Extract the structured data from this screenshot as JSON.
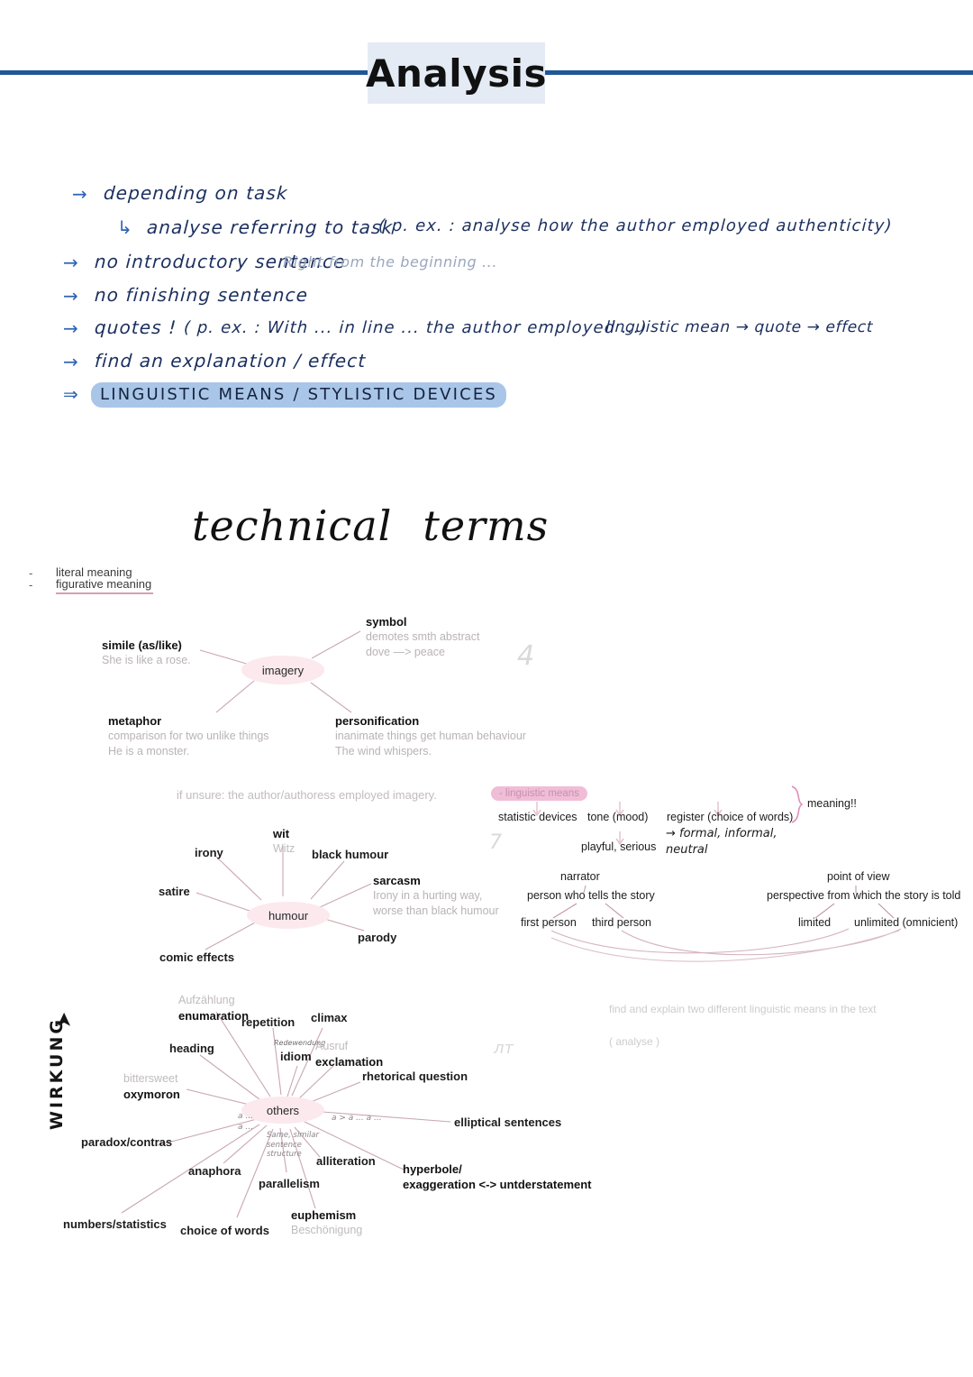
{
  "header": {
    "title": "Analysis",
    "rule_color": "#1f5797",
    "title_box_color": "#e4ebf4"
  },
  "notes": {
    "arrow_glyph": "→",
    "sub_arrow_glyph": "↳",
    "double_arrow_glyph": "⇒",
    "lines": [
      {
        "arrow": "→",
        "text": "depending  on  task"
      },
      {
        "arrow": "↳",
        "text": "analyse  referring  to  task",
        "extra": "( p. ex. :  analyse  how  the  author  employed  authenticity)"
      },
      {
        "arrow": "→",
        "text": "no  introductory  sentence",
        "faint": "Right  from  the  beginning ..."
      },
      {
        "arrow": "→",
        "text": "no  finishing  sentence"
      },
      {
        "arrow": "→",
        "text": "quotes !",
        "extra": "( p. ex. :  With  ...  in line ...  the author  employed ...)"
      },
      {
        "arrow": "→",
        "text": "find  an  explanation / effect"
      }
    ],
    "side_note": "linguistic mean → quote → effect",
    "highlight_line": {
      "arrow": "⇒",
      "text": "LINGUISTIC  MEANS  /  STYLISTIC  DEVICES",
      "highlight_color": "#a9c6e8"
    }
  },
  "technical_terms": {
    "word1": "technical",
    "word2": "terms"
  },
  "meanings": {
    "dash": "-",
    "items": [
      "literal meaning",
      "figurative meaning"
    ],
    "underline_color": "#cf8fa2"
  },
  "imagery_map": {
    "center": "imagery",
    "page_number": "4",
    "nodes": [
      {
        "title": "symbol",
        "desc1": "demotes smth abstract",
        "desc2": "dove —> peace"
      },
      {
        "title": "simile (as/like)",
        "desc1": "She is like a rose."
      },
      {
        "title": "metaphor",
        "desc1": "comparison for two unlike things",
        "desc2": "He is a monster."
      },
      {
        "title": "personification",
        "desc1": "inanimate things get human behaviour",
        "desc2": "The wind whispers."
      }
    ],
    "hint": "if unsure: the author/authoress employed imagery."
  },
  "humour_map": {
    "center": "humour",
    "pencil_mark": "7",
    "nodes": [
      {
        "title": "wit",
        "german": "Witz"
      },
      {
        "title": "irony"
      },
      {
        "title": "black humour"
      },
      {
        "title": "satire"
      },
      {
        "title": "sarcasm",
        "desc1": "Irony in a hurting way,",
        "desc2": "worse than black humour"
      },
      {
        "title": "parody"
      },
      {
        "title": "comic effects"
      }
    ]
  },
  "linguistic_means_tree": {
    "root_label": "- linguistic means",
    "root_highlight": "#f0bdd6",
    "arrow_glyph": "↓",
    "children": [
      "statistic devices",
      "tone (mood)",
      "register (choice of words)"
    ],
    "tone_child": "playful, serious",
    "register_handwritten": "→ formal, informal,\n      neutral",
    "brace_label": "meaning!!"
  },
  "narrator_tree": {
    "root": "narrator",
    "definition": "person who tells the story",
    "children": [
      "first person",
      "third person"
    ]
  },
  "pov_tree": {
    "root": "point of view",
    "definition": "perspective from which the story is told",
    "children": [
      "limited",
      "unlimited (omnicient)"
    ]
  },
  "others_map": {
    "center": "others",
    "pencil_mark": "лт",
    "nodes": [
      {
        "title": "enumaration",
        "german": "Aufzählung"
      },
      {
        "title": "repetition"
      },
      {
        "title": "climax"
      },
      {
        "title": "heading"
      },
      {
        "title": "idiom",
        "handwritten": "Redewendung"
      },
      {
        "title": "exclamation",
        "german": "Ausruf"
      },
      {
        "title": "rhetorical question"
      },
      {
        "title": "oxymoron",
        "german": "bittersweet"
      },
      {
        "title": "elliptical sentences",
        "handwritten": "a > a ...  a ..."
      },
      {
        "title": "paradox/contras"
      },
      {
        "title": "anaphora",
        "handwritten": "a ...\na ..."
      },
      {
        "title": "parallelism",
        "handwritten": "Same, similar\nsentence\nstructure"
      },
      {
        "title": "alliteration"
      },
      {
        "title": "hyperbole/",
        "desc1": "exaggeration <-> untderstatement"
      },
      {
        "title": "numbers/statistics"
      },
      {
        "title": "choice of words"
      },
      {
        "title": "euphemism",
        "german": "Beschönigung"
      }
    ]
  },
  "wirkung": {
    "text": "WIRKUNG",
    "flourish": "➤"
  },
  "task_note": {
    "line1": "find and explain two different linguistic means in the text",
    "line2": "(        analyse     )"
  }
}
